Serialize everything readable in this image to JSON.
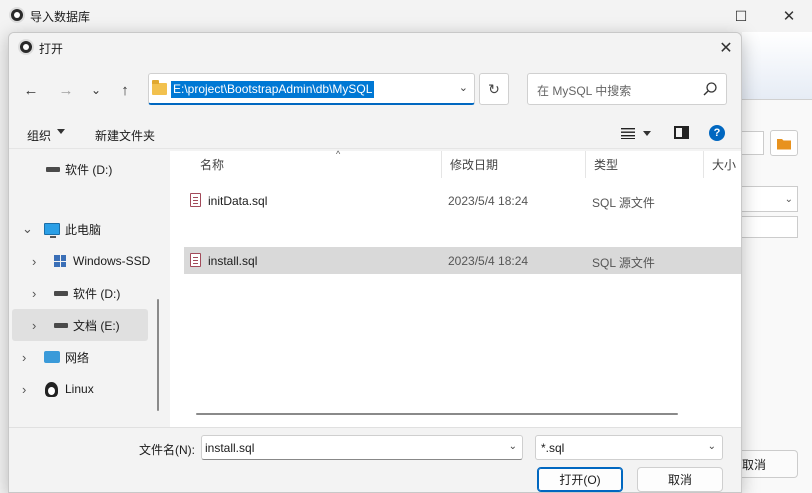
{
  "parent_window": {
    "title": "导入数据库",
    "cancel_label": "取消"
  },
  "dialog": {
    "title": "打开",
    "close_glyph": "✕"
  },
  "nav": {
    "back": "←",
    "forward": "→",
    "recent": "⌄",
    "up": "↑",
    "address": "E:\\project\\BootstrapAdmin\\db\\MySQL",
    "address_dropdown": "⌄",
    "refresh": "↻",
    "search_placeholder": "在 MySQL 中搜索"
  },
  "command_bar": {
    "organize": "组织",
    "new_folder": "新建文件夹",
    "help": "?"
  },
  "tree": [
    {
      "label": "软件 (D:)",
      "icon": "drive-icon",
      "chevron": "",
      "indent": 1,
      "selected": false
    },
    {
      "label": "此电脑",
      "icon": "pc-icon",
      "chevron": "⌄",
      "indent": 0,
      "selected": false
    },
    {
      "label": "Windows-SSD",
      "icon": "windows-icon",
      "chevron": "›",
      "indent": 1,
      "selected": false
    },
    {
      "label": "软件 (D:)",
      "icon": "drive-icon",
      "chevron": "›",
      "indent": 1,
      "selected": false
    },
    {
      "label": "文档 (E:)",
      "icon": "drive-icon",
      "chevron": "›",
      "indent": 1,
      "selected": true
    },
    {
      "label": "网络",
      "icon": "network-icon",
      "chevron": "›",
      "indent": 0,
      "selected": false
    },
    {
      "label": "Linux",
      "icon": "linux-icon",
      "chevron": "›",
      "indent": 0,
      "selected": false
    }
  ],
  "columns": [
    "名称",
    "修改日期",
    "类型",
    "大小"
  ],
  "sort_indicator": "^",
  "files": [
    {
      "name": "initData.sql",
      "date": "2023/5/4 18:24",
      "type": "SQL 源文件",
      "selected": false
    },
    {
      "name": "install.sql",
      "date": "2023/5/4 18:24",
      "type": "SQL 源文件",
      "selected": true
    }
  ],
  "footer": {
    "filename_label": "文件名(N):",
    "filename_value": "install.sql",
    "filetype_value": "*.sql",
    "dropdown_glyph": "⌄",
    "open_label": "打开(O)",
    "cancel_label": "取消"
  },
  "colors": {
    "accent": "#0067c0",
    "selection": "#0078d4",
    "sql_icon": "#a24a5a"
  }
}
